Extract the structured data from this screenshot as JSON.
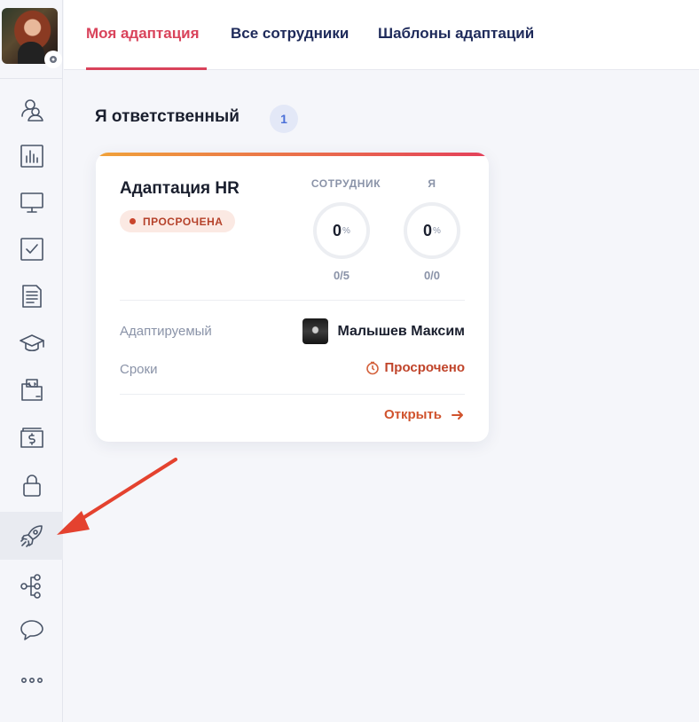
{
  "tabs": [
    {
      "label": "Моя адаптация",
      "active": true
    },
    {
      "label": "Все сотрудники",
      "active": false
    },
    {
      "label": "Шаблоны адаптаций",
      "active": false
    }
  ],
  "sidebar": {
    "items": [
      {
        "icon": "users-icon"
      },
      {
        "icon": "bar-chart-icon"
      },
      {
        "icon": "monitor-icon"
      },
      {
        "icon": "checkbox-icon"
      },
      {
        "icon": "document-icon"
      },
      {
        "icon": "graduation-cap-icon"
      },
      {
        "icon": "code-folder-icon"
      },
      {
        "icon": "money-icon"
      },
      {
        "icon": "lock-icon"
      },
      {
        "icon": "rocket-icon",
        "active": true
      },
      {
        "icon": "org-tree-icon"
      },
      {
        "icon": "chat-icon"
      },
      {
        "icon": "more-icon"
      }
    ]
  },
  "section": {
    "title": "Я ответственный",
    "count": "1"
  },
  "card": {
    "title": "Адаптация HR",
    "status": "ПРОСРОЧЕНА",
    "employee_label": "СОТРУДНИК",
    "employee_percent": "0",
    "employee_ratio": "0/5",
    "me_label": "Я",
    "me_percent": "0",
    "me_ratio": "0/0",
    "percent_sign": "%",
    "adaptee_label": "Адаптируемый",
    "adaptee_name": "Малышев Максим",
    "deadline_label": "Сроки",
    "deadline_value": "Просрочено",
    "open_label": "Открыть"
  },
  "colors": {
    "accent": "#d9435b",
    "tab_text": "#1e2a5a",
    "overdue": "#c0442a",
    "annotation_arrow": "#e4422f"
  }
}
